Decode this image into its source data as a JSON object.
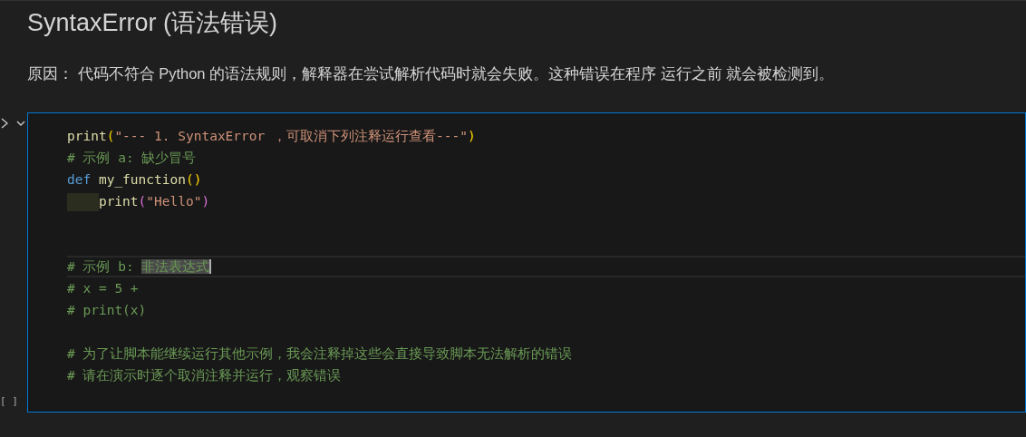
{
  "heading": "SyntaxError (语法错误)",
  "reason": "原因： 代码不符合 Python 的语法规则，解释器在尝试解析代码时就会失败。这种错误在程序 运行之前 就会被检测到。",
  "cell": {
    "expanded": true,
    "execution_count": "[ ]",
    "lines": [
      {
        "kind": "code",
        "current": false,
        "tokens": [
          {
            "kind": "function",
            "text": "print"
          },
          {
            "kind": "paren",
            "text": "("
          },
          {
            "kind": "string",
            "text": "\"--- 1. SyntaxError ，可取消下列注释运行查看---\""
          },
          {
            "kind": "paren",
            "text": ")"
          }
        ]
      },
      {
        "kind": "code",
        "current": false,
        "tokens": [
          {
            "kind": "comment",
            "text": "# 示例 a: 缺少冒号"
          }
        ]
      },
      {
        "kind": "code",
        "current": false,
        "tokens": [
          {
            "kind": "keyword",
            "text": "def "
          },
          {
            "kind": "function",
            "text": "my_function"
          },
          {
            "kind": "paren",
            "text": "()"
          }
        ]
      },
      {
        "kind": "code",
        "current": false,
        "indent": true,
        "tokens": [
          {
            "kind": "function",
            "text": "print"
          },
          {
            "kind": "paren2",
            "text": "("
          },
          {
            "kind": "string",
            "text": "\"Hello\""
          },
          {
            "kind": "paren2",
            "text": ")"
          }
        ]
      },
      {
        "kind": "blank"
      },
      {
        "kind": "blank"
      },
      {
        "kind": "code",
        "current": true,
        "tokens": [
          {
            "kind": "comment",
            "text": "# 示例 b: "
          },
          {
            "kind": "selected",
            "text": "非法表达式"
          }
        ]
      },
      {
        "kind": "code",
        "current": false,
        "tokens": [
          {
            "kind": "comment",
            "text": "# x = 5 +"
          }
        ]
      },
      {
        "kind": "code",
        "current": false,
        "tokens": [
          {
            "kind": "comment",
            "text": "# print(x)"
          }
        ]
      },
      {
        "kind": "blank"
      },
      {
        "kind": "code",
        "current": false,
        "tokens": [
          {
            "kind": "comment",
            "text": "# 为了让脚本能继续运行其他示例，我会注释掉这些会直接导致脚本无法解析的错误"
          }
        ]
      },
      {
        "kind": "code",
        "current": false,
        "tokens": [
          {
            "kind": "comment",
            "text": "# 请在演示时逐个取消注释并运行，观察错误"
          }
        ]
      }
    ]
  }
}
